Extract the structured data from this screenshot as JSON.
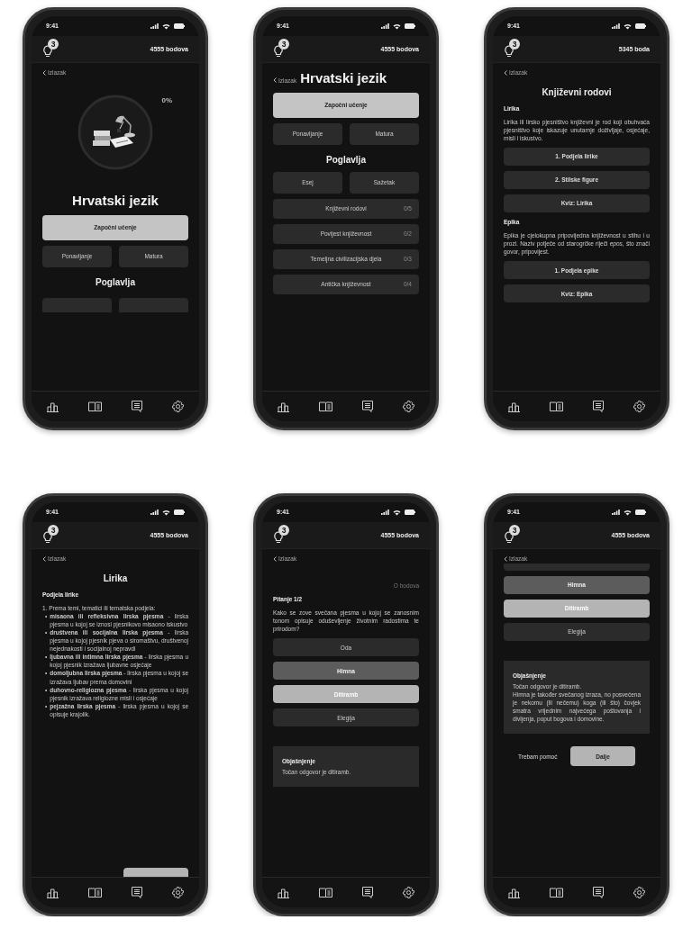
{
  "screens": [
    {
      "time": "9:41",
      "hints": "3",
      "points": "4555 bodova",
      "back": "Izlazak",
      "back_inline": false,
      "blocks": [
        {
          "kind": "illustration",
          "progress": {
            "level": 0,
            "reading": "0%"
          }
        },
        {
          "kind": "title",
          "text": "Hrvatski jezik"
        },
        {
          "kind": "primary",
          "label": "Započni učenje"
        },
        {
          "kind": "pair",
          "labels": [
            "Ponavljanje",
            "Matura"
          ]
        },
        {
          "kind": "heading",
          "text": "Poglavlja"
        },
        {
          "kind": "stub-pair"
        }
      ]
    },
    {
      "time": "9:41",
      "hints": "3",
      "points": "4555 bodova",
      "back": "Izlazak",
      "back_inline": true,
      "blocks": [
        {
          "kind": "title",
          "text": "Hrvatski jezik"
        },
        {
          "kind": "primary",
          "label": "Započni učenje"
        },
        {
          "kind": "pair",
          "labels": [
            "Ponavljanje",
            "Matura"
          ]
        },
        {
          "kind": "heading",
          "text": "Poglavlja"
        },
        {
          "kind": "pair",
          "labels": [
            "Esej",
            "Sažetak"
          ]
        },
        {
          "kind": "chapter",
          "label": "Književni rodovi",
          "count": "0/5"
        },
        {
          "kind": "chapter",
          "label": "Povijest književnost",
          "count": "0/2"
        },
        {
          "kind": "chapter",
          "label": "Temeljna civilizacijska djela",
          "count": "0/3"
        },
        {
          "kind": "chapter",
          "label": "Antička književnost",
          "count": "0/4"
        }
      ]
    },
    {
      "time": "9:41",
      "hints": "3",
      "points": "5345 boda",
      "back": "Izlazak",
      "back_inline": false,
      "blocks": [
        {
          "kind": "heading",
          "text": "Književni rodovi"
        },
        {
          "kind": "subheading",
          "text": "Lirika"
        },
        {
          "kind": "paragraph",
          "text": "Lirika ili lirsko pjesništvo književni je rod koji obuhvaća pjesništvo koje iskazuje unutarnje doživljaje, osjećaje, misli i iskustvo."
        },
        {
          "kind": "nav",
          "label": "1. Podjela lirike"
        },
        {
          "kind": "nav",
          "label": "2. Stilske figure"
        },
        {
          "kind": "nav",
          "label": "Kviz: Lirika"
        },
        {
          "kind": "subheading",
          "text": "Epika"
        },
        {
          "kind": "paragraph",
          "text": "Epika je cjelokupna pripovijedna književnost u stihu i u prozi. Naziv potječe od starogrčke riječi *epos*, što znači govor, pripovijest."
        },
        {
          "kind": "nav",
          "label": "1. Podjela epike"
        },
        {
          "kind": "nav",
          "label": "Kviz: Epika"
        }
      ]
    },
    {
      "time": "9:41",
      "hints": "3",
      "points": "4555 bodova",
      "back": "Izlazak",
      "back_inline": false,
      "blocks": [
        {
          "kind": "heading",
          "text": "Lirika"
        },
        {
          "kind": "subheading",
          "text": "Podjela lirike"
        },
        {
          "kind": "bullets",
          "marker": "•",
          "intro": "1. Prema temi, tematici ili tematska podjela:",
          "items": [
            "**misaona ili refleksivna lirska pjesma** - lirska pjesma u kojoj se iznosi pjesnikovo misaono iskustvo",
            "**društvena ili socijalna lirska pjesma** - lirska pjesma u kojoj pjesnik pjeva o siromaštvu, društvenoj nejednakosti i socijalnoj nepravdi",
            "**ljubavna ili intimna lirska pjesma** - lirska pjesma u kojoj pjesnik izražava ljubavne osjećaje",
            "**domoljubna lirska pjesma** - lirska pjesma u kojoj se izražava ljubav prema domovini",
            "**duhovno-religiozna pjesma** - lirska pjesma u kojoj pjesnik izražava religiozne misli i osjećaje",
            "**pejzažna lirska pjesma** - lirska pjesma u kojoj se opisuje krajolik."
          ]
        },
        {
          "kind": "stub-footer"
        }
      ]
    },
    {
      "time": "9:41",
      "hints": "3",
      "points": "4555 bodova",
      "back": "Izlazak",
      "back_inline": false,
      "blocks": [
        {
          "kind": "score",
          "text": "O bodova"
        },
        {
          "kind": "subheading",
          "text": "Pitanje 1/2"
        },
        {
          "kind": "paragraph",
          "text": "Kako se zove svečana pjesma u kojoj se zanosnim tonom opisuje oduševljenje životnim radostima te prirodom?"
        },
        {
          "kind": "option",
          "label": "Oda",
          "selected": false,
          "correct": false
        },
        {
          "kind": "option",
          "label": "Himna",
          "selected": true,
          "correct": false
        },
        {
          "kind": "option",
          "label": "Ditiramb",
          "selected": false,
          "correct": true
        },
        {
          "kind": "option",
          "label": "Elegija",
          "selected": false,
          "correct": false
        },
        {
          "kind": "explanation",
          "title": "Objašnjenje",
          "lines": [
            "Točan odgovor je ditiramb."
          ]
        }
      ]
    },
    {
      "time": "9:41",
      "hints": "3",
      "points": "4555 bodova",
      "back": "Izlazak",
      "back_inline": false,
      "blocks": [
        {
          "kind": "stub-option"
        },
        {
          "kind": "option",
          "label": "Himna",
          "selected": true,
          "correct": false
        },
        {
          "kind": "option",
          "label": "Ditiramb",
          "selected": false,
          "correct": true
        },
        {
          "kind": "option",
          "label": "Elegija",
          "selected": false,
          "correct": false
        },
        {
          "kind": "explanation",
          "title": "Objašnjenje",
          "lines": [
            "Točan odgovor je ditiramb.",
            "Himna je također svečanog izraza, no posvećena je nekomu (ili nečemu) koga (ili što) čovjek smatra vrijednim najvećega poštovanja i divljenja, poput bogova i domovine."
          ]
        },
        {
          "kind": "footer",
          "help": "Trebam pomoć",
          "next": "Dalje"
        }
      ]
    }
  ]
}
